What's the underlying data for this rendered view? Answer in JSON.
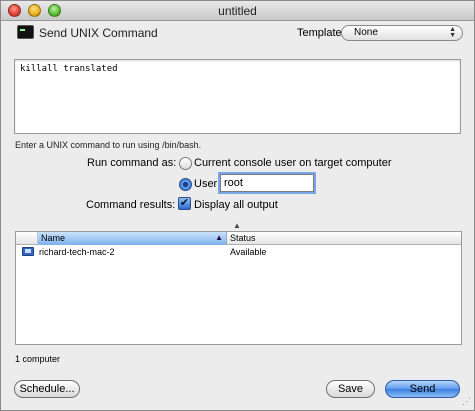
{
  "window": {
    "title": "untitled"
  },
  "toolbar": {
    "title": "Send UNIX Command",
    "template_label": "Template:",
    "template_value": "None",
    "template_arrows": "▲\n▼"
  },
  "command": {
    "text": "killall translated"
  },
  "hint": "Enter a UNIX command to run using /bin/bash.",
  "run_as": {
    "label": "Run command as:",
    "option1": "Current console user on target computer",
    "option2": "User:",
    "selected": "User",
    "user_value": "root"
  },
  "results": {
    "label": "Command results:",
    "checkbox_label": "Display all output",
    "checked": true
  },
  "table": {
    "columns": [
      "Name",
      "Status"
    ],
    "sort_indicator": "▲",
    "rows": [
      {
        "name": "richard-tech-mac-2",
        "status": "Available"
      }
    ]
  },
  "footer": {
    "count": "1 computer",
    "schedule_label": "Schedule...",
    "save_label": "Save",
    "send_label": "Send"
  },
  "glyphs": {
    "checkmark": "✔",
    "splitter": "▲",
    "grip": "⋰"
  }
}
